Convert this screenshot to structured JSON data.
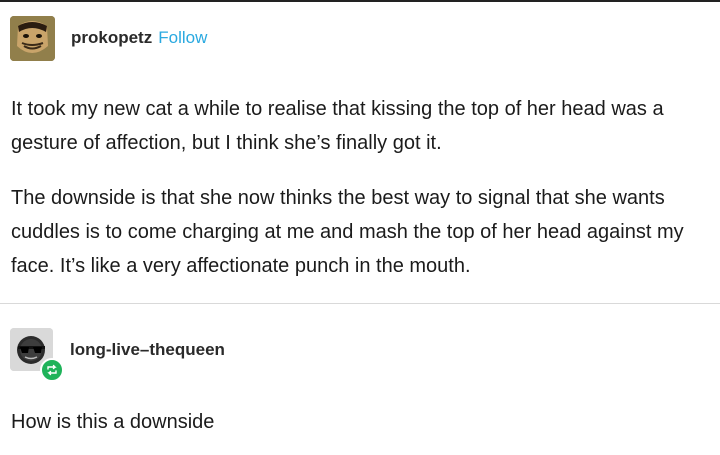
{
  "post": {
    "author": "prokopetz",
    "follow_label": "Follow",
    "paragraphs": [
      "It took my new cat a while to realise that kissing the top of her head was a gesture of affection, but I think she’s finally got it.",
      "The downside is that she now thinks the best way to signal that she wants cuddles is to come charging at me and mash the top of her head against my face. It’s like a very affectionate punch in the mouth."
    ]
  },
  "reblog": {
    "author": "long-live–thequeen",
    "text": "How is this a downside",
    "badge_icon": "reblog-icon"
  },
  "colors": {
    "follow": "#2aa9e0",
    "reblog_badge": "#1fb35a"
  }
}
